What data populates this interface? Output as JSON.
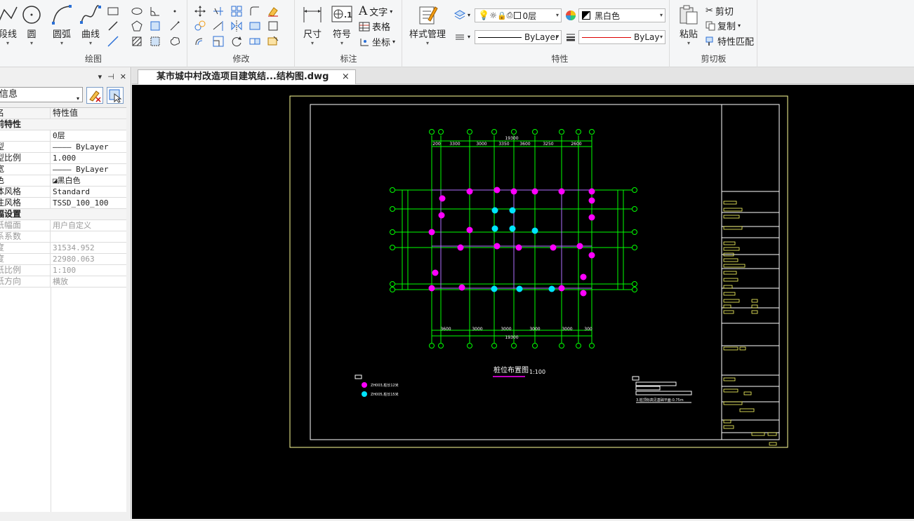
{
  "ribbon": {
    "draw": {
      "buttons": [
        "段线",
        "圆",
        "圆弧",
        "曲线"
      ],
      "label": "绘图"
    },
    "modify": {
      "label": "修改"
    },
    "annotate": {
      "dimension": "尺寸",
      "symbol": "符号",
      "text": "文字",
      "table": "表格",
      "coord": "坐标",
      "label": "标注"
    },
    "style": {
      "button": "样式管理"
    },
    "properties": {
      "layer": "0层",
      "color": "黑白色",
      "linetype": "ByLayer",
      "lineweight": "ByLay",
      "label": "特性"
    },
    "clipboard": {
      "paste": "粘贴",
      "cut": "剪切",
      "copy": "复制",
      "match": "特性匹配",
      "label": "剪切板"
    }
  },
  "props_panel": {
    "pin": "⊣",
    "close": "✕",
    "selector": "信息",
    "header": {
      "name": "名",
      "value": "特性值"
    },
    "rows": [
      {
        "type": "sec",
        "k": "前特性"
      },
      {
        "k": "",
        "v": "0层"
      },
      {
        "k": "型",
        "v": "———— ByLayer"
      },
      {
        "k": "型比例",
        "v": "1.000"
      },
      {
        "k": "宽",
        "v": "———— ByLayer"
      },
      {
        "k": "色",
        "v": "◪黑白色"
      },
      {
        "k": "体风格",
        "v": "Standard"
      },
      {
        "k": "注风格",
        "v": "TSSD_100_100"
      },
      {
        "type": "sec",
        "k": "幅设置"
      },
      {
        "type": "dim",
        "k": "纸幅面",
        "v": "用户自定义"
      },
      {
        "type": "dim",
        "k": "系系数",
        "v": ""
      },
      {
        "type": "dim",
        "k": "度",
        "v": "31534.952"
      },
      {
        "type": "dim",
        "k": "度",
        "v": "22980.063"
      },
      {
        "type": "dim",
        "k": "纸比例",
        "v": "1:100"
      },
      {
        "type": "dim",
        "k": "纸方向",
        "v": "横放"
      }
    ]
  },
  "document": {
    "tab_title": "某市城中村改造项目建筑结...结构图.dwg",
    "close": "×"
  },
  "drawing": {
    "top_dims": [
      "200",
      "3300",
      "3000",
      "3350",
      "3600",
      "3250",
      "2600"
    ],
    "top_total": "19300",
    "bottom_dims": [
      "3600",
      "3000",
      "3000",
      "3000",
      "3000",
      "300"
    ],
    "bottom_total": "19300",
    "title": "桩位布置图",
    "scale": "1:100",
    "legend": [
      "ZH003,桩长12米",
      "ZH005,桩长15米"
    ],
    "note": "3.桩顶标高见基础平面-0.75m"
  },
  "colors": {
    "canvas": "#000000",
    "frame": "#ffffff",
    "border": "#ffff99",
    "grid": "#00ff00",
    "pile_a": "#ff00ff",
    "pile_b": "#00e5ff",
    "text": "#ffff66"
  }
}
